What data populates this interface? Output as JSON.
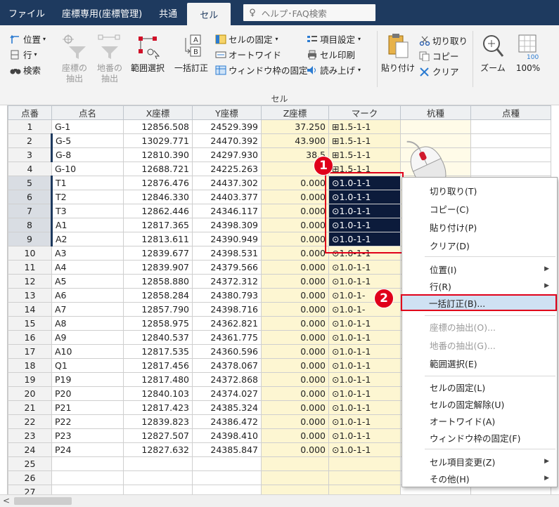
{
  "tabs": [
    "ファイル",
    "座標専用(座標管理)",
    "共通",
    "セル"
  ],
  "active_tab": "セル",
  "help_placeholder": "ヘルプ･FAQ検索",
  "ribbon": {
    "position": "位置",
    "row": "行",
    "search": "検索",
    "coord_extract": [
      "座標の",
      "抽出"
    ],
    "lot_extract": [
      "地番の",
      "抽出"
    ],
    "range_select": "範囲選択",
    "bulk_edit": "一括訂正",
    "cell_fix": "セルの固定",
    "auto_wide": "オートワイド",
    "window_fix": "ウィンドウ枠の固定",
    "item_setting": "項目設定",
    "cell_print": "セル印刷",
    "read_aloud": "読み上げ",
    "paste": "貼り付け",
    "cut": "切り取り",
    "copy": "コピー",
    "clear": "クリア",
    "zoom": "ズーム",
    "zoom_100": "100%",
    "zoom_icon_label": "100",
    "group_label": "セル"
  },
  "grid": {
    "headers": [
      "点番",
      "点名",
      "X座標",
      "Y座標",
      "Z座標",
      "マーク",
      "杭種",
      "点種"
    ],
    "rows": [
      [
        "1",
        "G-1",
        "12856.508",
        "24529.399",
        "37.250",
        "⊞1.5-1-1"
      ],
      [
        "2",
        "G-5",
        "13029.771",
        "24470.392",
        "43.900",
        "⊞1.5-1-1"
      ],
      [
        "3",
        "G-8",
        "12810.390",
        "24297.930",
        "38.5",
        "⊞1.5-1-1"
      ],
      [
        "4",
        "G-10",
        "12688.721",
        "24225.263",
        "0.",
        "⊞1.5-1-1"
      ],
      [
        "5",
        "T1",
        "12876.476",
        "24437.302",
        "0.000",
        "⊙1.0-1-1"
      ],
      [
        "6",
        "T2",
        "12846.330",
        "24403.377",
        "0.000",
        "⊙1.0-1-1"
      ],
      [
        "7",
        "T3",
        "12862.446",
        "24346.117",
        "0.000",
        "⊙1.0-1-1"
      ],
      [
        "8",
        "A1",
        "12817.365",
        "24398.309",
        "0.000",
        "⊙1.0-1-1"
      ],
      [
        "9",
        "A2",
        "12813.611",
        "24390.949",
        "0.000",
        "⊙1.0-1-1"
      ],
      [
        "10",
        "A3",
        "12839.677",
        "24398.531",
        "0.000",
        "⊙1.0-1-1"
      ],
      [
        "11",
        "A4",
        "12839.907",
        "24379.566",
        "0.000",
        "⊙1.0-1-1"
      ],
      [
        "12",
        "A5",
        "12858.880",
        "24372.312",
        "0.000",
        "⊙1.0-1-1"
      ],
      [
        "13",
        "A6",
        "12858.284",
        "24380.793",
        "0.000",
        "⊙1.0-1-"
      ],
      [
        "14",
        "A7",
        "12857.790",
        "24398.716",
        "0.000",
        "⊙1.0-1-"
      ],
      [
        "15",
        "A8",
        "12858.975",
        "24362.821",
        "0.000",
        "⊙1.0-1-1"
      ],
      [
        "16",
        "A9",
        "12840.537",
        "24361.775",
        "0.000",
        "⊙1.0-1-1"
      ],
      [
        "17",
        "A10",
        "12817.535",
        "24360.596",
        "0.000",
        "⊙1.0-1-1"
      ],
      [
        "18",
        "Q1",
        "12817.456",
        "24378.067",
        "0.000",
        "⊙1.0-1-1"
      ],
      [
        "19",
        "P19",
        "12817.480",
        "24372.868",
        "0.000",
        "⊙1.0-1-1"
      ],
      [
        "20",
        "P20",
        "12840.103",
        "24374.027",
        "0.000",
        "⊙1.0-1-1"
      ],
      [
        "21",
        "P21",
        "12817.423",
        "24385.324",
        "0.000",
        "⊙1.0-1-1"
      ],
      [
        "22",
        "P22",
        "12839.823",
        "24386.472",
        "0.000",
        "⊙1.0-1-1"
      ],
      [
        "23",
        "P23",
        "12827.507",
        "24398.410",
        "0.000",
        "⊙1.0-1-1"
      ],
      [
        "24",
        "P24",
        "12827.632",
        "24385.847",
        "0.000",
        "⊙1.0-1-1"
      ],
      [
        "25",
        "",
        "",
        "",
        "",
        ""
      ],
      [
        "26",
        "",
        "",
        "",
        "",
        ""
      ],
      [
        "27",
        "",
        "",
        "",
        "",
        ""
      ]
    ]
  },
  "context_menu": {
    "items": [
      {
        "label": "切り取り(T)",
        "enabled": true
      },
      {
        "label": "コピー(C)",
        "enabled": true
      },
      {
        "label": "貼り付け(P)",
        "enabled": true
      },
      {
        "label": "クリア(D)",
        "enabled": true
      },
      {
        "label": "位置(I)",
        "enabled": true,
        "submenu": true
      },
      {
        "label": "行(R)",
        "enabled": true,
        "submenu": true
      },
      {
        "label": "一括訂正(B)...",
        "enabled": true,
        "highlighted": true
      },
      {
        "label": "座標の抽出(O)...",
        "enabled": false
      },
      {
        "label": "地番の抽出(G)...",
        "enabled": false
      },
      {
        "label": "範囲選択(E)",
        "enabled": true
      },
      {
        "label": "セルの固定(L)",
        "enabled": true
      },
      {
        "label": "セルの固定解除(U)",
        "enabled": true
      },
      {
        "label": "オートワイド(A)",
        "enabled": true
      },
      {
        "label": "ウィンドウ枠の固定(F)",
        "enabled": true
      },
      {
        "label": "セル項目変更(Z)",
        "enabled": true,
        "submenu": true
      },
      {
        "label": "その他(H)",
        "enabled": true,
        "submenu": true
      }
    ]
  },
  "callouts": [
    "1",
    "2"
  ],
  "colors": {
    "tabbar": "#1e3a5f",
    "accent_red": "#e0001a",
    "selection": "#0c1b3b",
    "highlight": "#cfe1f3"
  }
}
